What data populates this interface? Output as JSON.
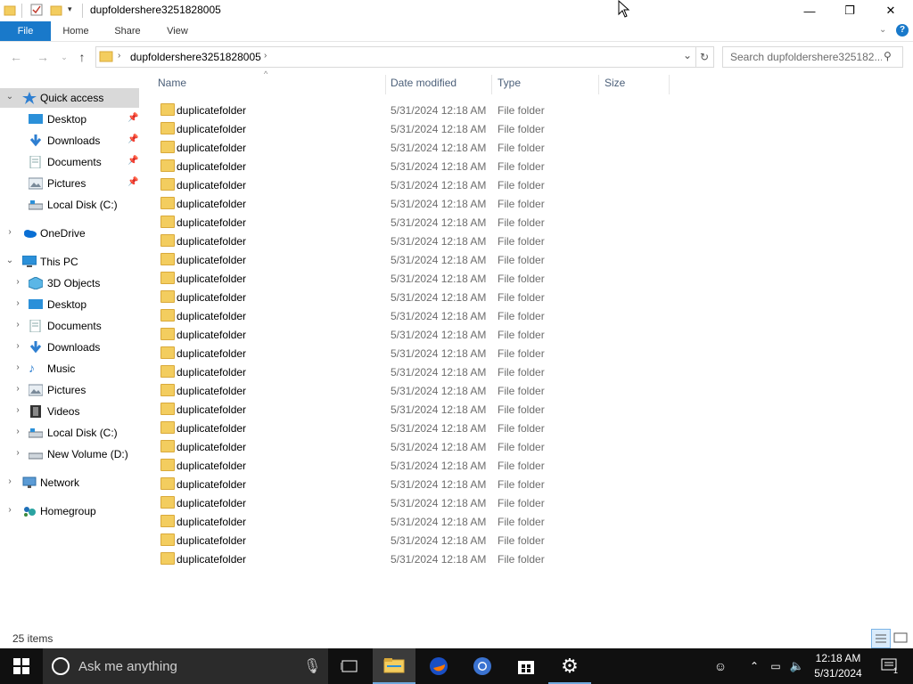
{
  "window": {
    "title": "dupfoldershere3251828005",
    "minimize_label": "—",
    "restore_label": "❐",
    "close_label": "✕"
  },
  "ribbon": {
    "tabs": [
      "File",
      "Home",
      "Share",
      "View"
    ]
  },
  "address": {
    "path": "dupfoldershere3251828005",
    "search_placeholder": "Search dupfoldershere325182..."
  },
  "nav": {
    "quick_access": "Quick access",
    "qa_items": [
      "Desktop",
      "Downloads",
      "Documents",
      "Pictures",
      "Local Disk (C:)"
    ],
    "onedrive": "OneDrive",
    "this_pc": "This PC",
    "pc_items": [
      "3D Objects",
      "Desktop",
      "Documents",
      "Downloads",
      "Music",
      "Pictures",
      "Videos",
      "Local Disk (C:)",
      "New Volume (D:)"
    ],
    "network": "Network",
    "homegroup": "Homegroup"
  },
  "columns": {
    "name": "Name",
    "date": "Date modified",
    "type": "Type",
    "size": "Size"
  },
  "files": [
    {
      "name": "duplicatefolder",
      "date": "5/31/2024 12:18 AM",
      "type": "File folder"
    },
    {
      "name": "duplicatefolder",
      "date": "5/31/2024 12:18 AM",
      "type": "File folder"
    },
    {
      "name": "duplicatefolder",
      "date": "5/31/2024 12:18 AM",
      "type": "File folder"
    },
    {
      "name": "duplicatefolder",
      "date": "5/31/2024 12:18 AM",
      "type": "File folder"
    },
    {
      "name": "duplicatefolder",
      "date": "5/31/2024 12:18 AM",
      "type": "File folder"
    },
    {
      "name": "duplicatefolder",
      "date": "5/31/2024 12:18 AM",
      "type": "File folder"
    },
    {
      "name": "duplicatefolder",
      "date": "5/31/2024 12:18 AM",
      "type": "File folder"
    },
    {
      "name": "duplicatefolder",
      "date": "5/31/2024 12:18 AM",
      "type": "File folder"
    },
    {
      "name": "duplicatefolder",
      "date": "5/31/2024 12:18 AM",
      "type": "File folder"
    },
    {
      "name": "duplicatefolder",
      "date": "5/31/2024 12:18 AM",
      "type": "File folder"
    },
    {
      "name": "duplicatefolder",
      "date": "5/31/2024 12:18 AM",
      "type": "File folder"
    },
    {
      "name": "duplicatefolder",
      "date": "5/31/2024 12:18 AM",
      "type": "File folder"
    },
    {
      "name": "duplicatefolder",
      "date": "5/31/2024 12:18 AM",
      "type": "File folder"
    },
    {
      "name": "duplicatefolder",
      "date": "5/31/2024 12:18 AM",
      "type": "File folder"
    },
    {
      "name": "duplicatefolder",
      "date": "5/31/2024 12:18 AM",
      "type": "File folder"
    },
    {
      "name": "duplicatefolder",
      "date": "5/31/2024 12:18 AM",
      "type": "File folder"
    },
    {
      "name": "duplicatefolder",
      "date": "5/31/2024 12:18 AM",
      "type": "File folder"
    },
    {
      "name": "duplicatefolder",
      "date": "5/31/2024 12:18 AM",
      "type": "File folder"
    },
    {
      "name": "duplicatefolder",
      "date": "5/31/2024 12:18 AM",
      "type": "File folder"
    },
    {
      "name": "duplicatefolder",
      "date": "5/31/2024 12:18 AM",
      "type": "File folder"
    },
    {
      "name": "duplicatefolder",
      "date": "5/31/2024 12:18 AM",
      "type": "File folder"
    },
    {
      "name": "duplicatefolder",
      "date": "5/31/2024 12:18 AM",
      "type": "File folder"
    },
    {
      "name": "duplicatefolder",
      "date": "5/31/2024 12:18 AM",
      "type": "File folder"
    },
    {
      "name": "duplicatefolder",
      "date": "5/31/2024 12:18 AM",
      "type": "File folder"
    },
    {
      "name": "duplicatefolder",
      "date": "5/31/2024 12:18 AM",
      "type": "File folder"
    }
  ],
  "status": {
    "item_count": "25 items"
  },
  "taskbar": {
    "search_text": "Ask me anything",
    "time": "12:18 AM",
    "date": "5/31/2024",
    "notification_count": "1"
  },
  "colors": {
    "accent": "#1979ca",
    "folder": "#f3cd5f",
    "taskbar": "#101010"
  }
}
